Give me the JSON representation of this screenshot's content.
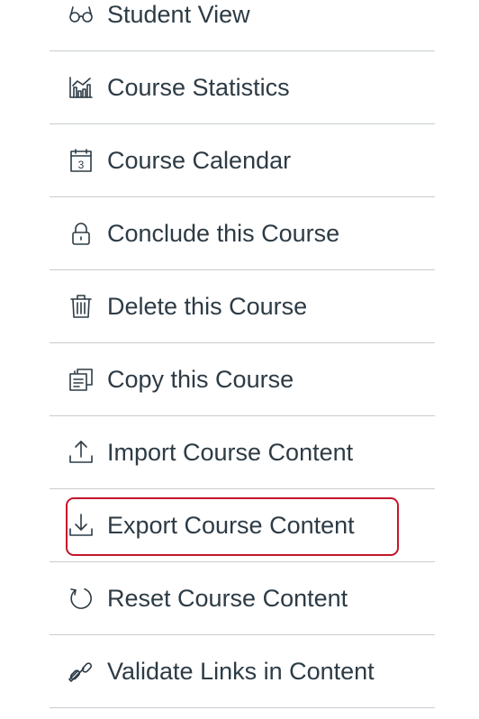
{
  "menu": {
    "items": [
      {
        "label": "Student View",
        "icon": "glasses-icon"
      },
      {
        "label": "Course Statistics",
        "icon": "bar-chart-icon"
      },
      {
        "label": "Course Calendar",
        "icon": "calendar-icon"
      },
      {
        "label": "Conclude this Course",
        "icon": "lock-icon"
      },
      {
        "label": "Delete this Course",
        "icon": "trash-icon"
      },
      {
        "label": "Copy this Course",
        "icon": "copy-icon"
      },
      {
        "label": "Import Course Content",
        "icon": "upload-icon"
      },
      {
        "label": "Export Course Content",
        "icon": "download-icon",
        "highlighted": true
      },
      {
        "label": "Reset Course Content",
        "icon": "reset-icon"
      },
      {
        "label": "Validate Links in Content",
        "icon": "link-icon"
      }
    ],
    "calendar_day": "3",
    "highlight_color": "#c3162b",
    "text_color": "#2d3b45",
    "divider_color": "#c7cdd1"
  }
}
